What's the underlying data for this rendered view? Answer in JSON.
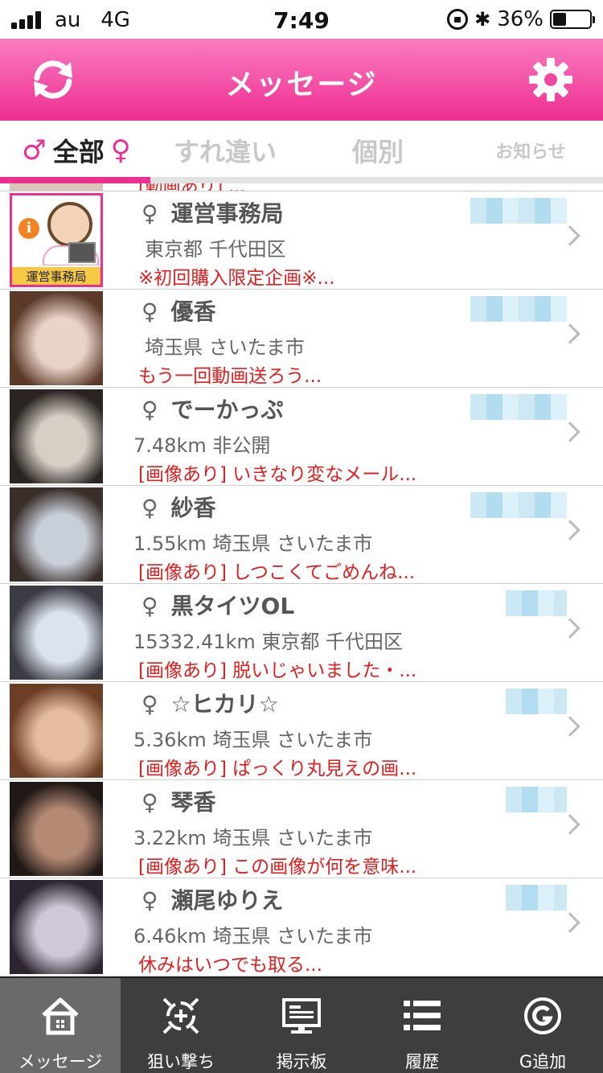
{
  "status_bar": {
    "carrier": "au",
    "network": "4G",
    "time": "7:49",
    "battery": "36%",
    "battery_level": 0.36
  },
  "header": {
    "title": "メッセージ",
    "left_icon": "refresh-icon",
    "right_icon": "gear-icon"
  },
  "tabs": [
    {
      "label": "全部",
      "prefix": "♂",
      "suffix": "♀",
      "active": true
    },
    {
      "label": "すれ違い",
      "active": false
    },
    {
      "label": "個別",
      "active": false
    },
    {
      "label": "お知らせ",
      "active": false
    }
  ],
  "peek_text": "[動画あり] ...",
  "messages": [
    {
      "name": "運営事務局",
      "gender": "♀",
      "location": "東京都 千代田区",
      "preview": "※初回購入限定企画※...",
      "avatar": "office-avatar",
      "avatar_label": "運営事務局"
    },
    {
      "name": "優香",
      "gender": "♀",
      "location": "埼玉県 さいたま市",
      "preview": "もう一回動画送ろう...",
      "avatar": "photo-avatar"
    },
    {
      "name": "でーかっぷ",
      "gender": "♀",
      "location": "7.48km  非公開",
      "preview": "[画像あり] いきなり変なメール...",
      "avatar": "photo-avatar"
    },
    {
      "name": "紗香",
      "gender": "♀",
      "location": "1.55km  埼玉県 さいたま市",
      "preview": "[画像あり] しつこくてごめんね...",
      "avatar": "photo-avatar"
    },
    {
      "name": "黒タイツOL",
      "gender": "♀",
      "location": "15332.41km  東京都 千代田区",
      "preview": "[画像あり] 脱いじゃいました・...",
      "avatar": "photo-avatar"
    },
    {
      "name": "☆ヒカリ☆",
      "gender": "♀",
      "location": "5.36km  埼玉県 さいたま市",
      "preview": "[画像あり] ぱっくり丸見えの画...",
      "avatar": "photo-avatar"
    },
    {
      "name": "琴香",
      "gender": "♀",
      "location": "3.22km  埼玉県 さいたま市",
      "preview": "[画像あり] この画像が何を意味...",
      "avatar": "photo-avatar"
    },
    {
      "name": "瀬尾ゆりえ",
      "gender": "♀",
      "location": "6.46km  埼玉県 さいたま市",
      "preview": "休みはいつでも取る...",
      "avatar": "photo-avatar"
    }
  ],
  "bottom_tabs": [
    {
      "label": "メッセージ",
      "icon": "home-icon",
      "active": true
    },
    {
      "label": "狙い撃ち",
      "icon": "target-icon",
      "active": false
    },
    {
      "label": "掲示板",
      "icon": "board-icon",
      "active": false
    },
    {
      "label": "履歴",
      "icon": "list-icon",
      "active": false
    },
    {
      "label": "G追加",
      "icon": "g-coin-icon",
      "active": false
    }
  ],
  "colors": {
    "accent": "#ef2e92",
    "preview_text": "#e02020",
    "tabbar_bg": "#3e3e3e"
  }
}
